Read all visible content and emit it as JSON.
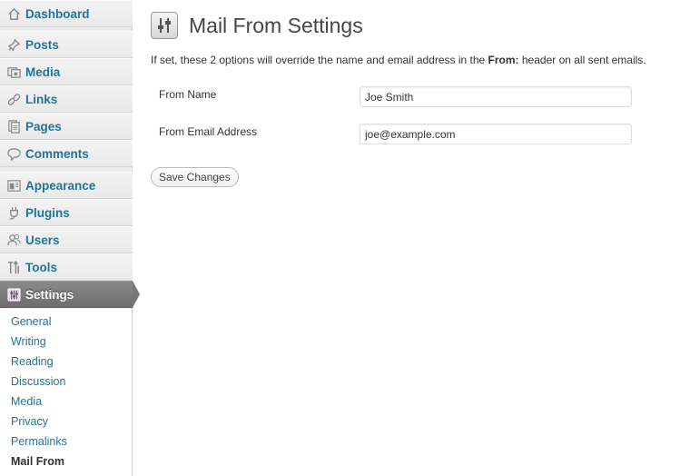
{
  "sidebar": {
    "items": [
      {
        "label": "Dashboard",
        "icon": "dashboard-icon"
      },
      {
        "label": "Posts",
        "icon": "posts-pin-icon"
      },
      {
        "label": "Media",
        "icon": "media-icon"
      },
      {
        "label": "Links",
        "icon": "links-icon"
      },
      {
        "label": "Pages",
        "icon": "pages-icon"
      },
      {
        "label": "Comments",
        "icon": "comments-icon"
      },
      {
        "label": "Appearance",
        "icon": "appearance-icon"
      },
      {
        "label": "Plugins",
        "icon": "plugins-icon"
      },
      {
        "label": "Users",
        "icon": "users-icon"
      },
      {
        "label": "Tools",
        "icon": "tools-icon"
      },
      {
        "label": "Settings",
        "icon": "settings-icon",
        "current": true
      }
    ],
    "submenu": [
      "General",
      "Writing",
      "Reading",
      "Discussion",
      "Media",
      "Privacy",
      "Permalinks",
      "Mail From"
    ],
    "submenu_current": "Mail From"
  },
  "main": {
    "title": "Mail From Settings",
    "description_before": "If set, these 2 options will override the name and email address in the ",
    "description_bold": "From:",
    "description_after": " header on all sent emails.",
    "fields": [
      {
        "label": "From Name",
        "value": "Joe Smith"
      },
      {
        "label": "From Email Address",
        "value": "joe@example.com"
      }
    ],
    "save_label": "Save Changes"
  },
  "colors": {
    "link": "#21759b",
    "current_menu_bg": "#777777",
    "sidebar_bg": "#ececec"
  }
}
